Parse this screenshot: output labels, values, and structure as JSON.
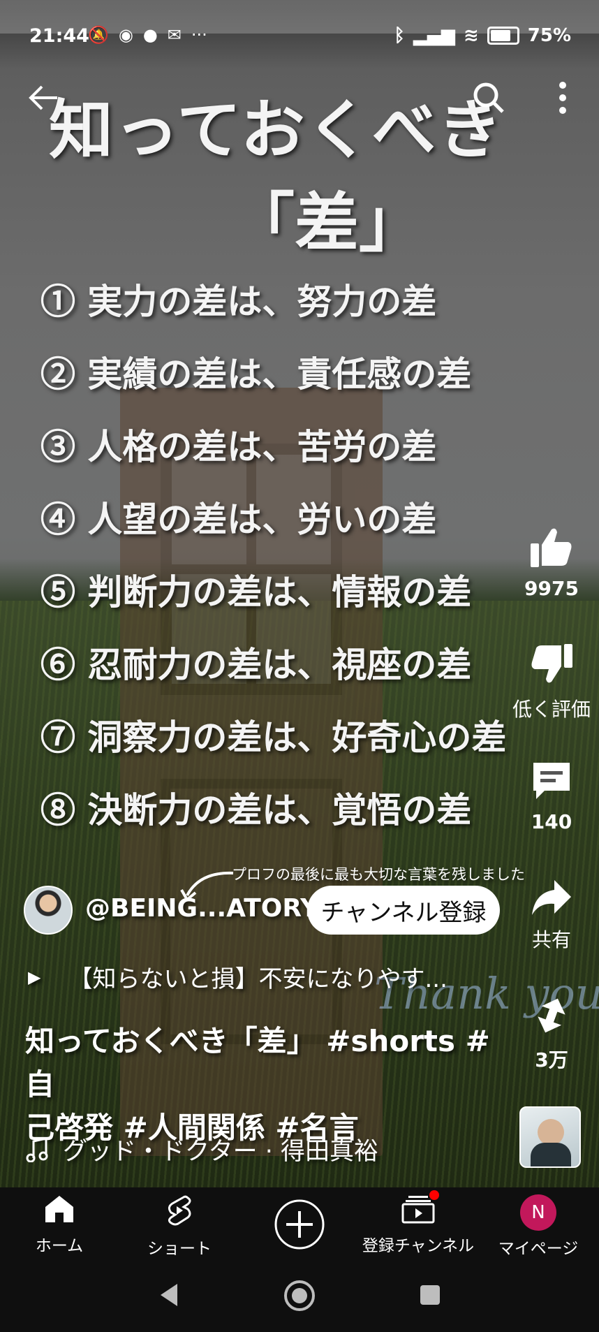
{
  "status_bar": {
    "time": "21:44",
    "left_icons": [
      "silent-icon",
      "chrome-icon",
      "line-icon",
      "mail-icon",
      "more-notifications-icon"
    ],
    "more_dots": "···",
    "battery": "75%"
  },
  "video": {
    "title": "知っておくべき",
    "subtitle": "「差」",
    "items": [
      "① 実力の差は、努力の差",
      "② 実績の差は、責任感の差",
      "③ 人格の差は、苦労の差",
      "④ 人望の差は、労いの差",
      "⑤ 判断力の差は、情報の差",
      "⑥ 忍耐力の差は、視座の差",
      "⑦ 洞察力の差は、好奇心の差",
      "⑧ 決断力の差は、覚悟の差"
    ],
    "note": "プロフの最後に最も大切な言葉を残しました",
    "overlay_text": "Thank you"
  },
  "actions": {
    "like_count": "9975",
    "dislike_label": "低く評価",
    "comment_count": "140",
    "share_label": "共有",
    "remix_count": "3万"
  },
  "channel": {
    "name": "@BEING...ATORY",
    "subscribe_label": "チャンネル登録"
  },
  "playlist_text": "【知らないと損】不安になりやす...",
  "description": {
    "line1": "知っておくべき「差」 #shorts #自",
    "line2": "己啓発 #人間関係 #名言"
  },
  "music": "グッド・ドクター · 得田真裕",
  "bottom_nav": {
    "home": "ホーム",
    "shorts": "ショート",
    "subscriptions": "登録チャンネル",
    "mypage": "マイページ",
    "avatar_letter": "N"
  },
  "colors": {
    "nav_bg": "#0f0f0f",
    "avatar_bg": "#c2185b",
    "notification_dot": "#ff0000"
  }
}
